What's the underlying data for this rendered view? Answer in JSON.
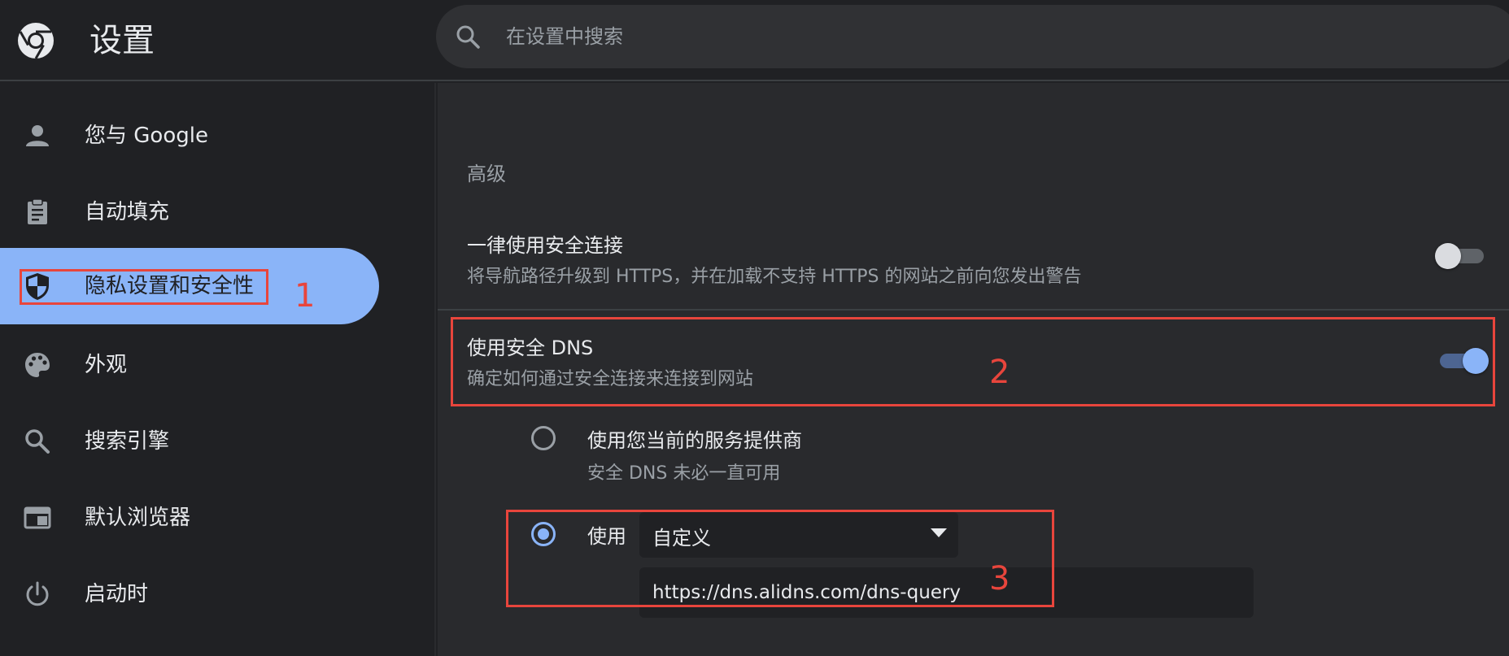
{
  "header": {
    "title": "设置",
    "search_placeholder": "在设置中搜索"
  },
  "sidebar": {
    "items": [
      {
        "label": "您与 Google",
        "icon": "person-icon"
      },
      {
        "label": "自动填充",
        "icon": "clipboard-icon"
      },
      {
        "label": "隐私设置和安全性",
        "icon": "shield-icon",
        "active": true
      },
      {
        "label": "外观",
        "icon": "palette-icon"
      },
      {
        "label": "搜索引擎",
        "icon": "search-icon"
      },
      {
        "label": "默认浏览器",
        "icon": "browser-window-icon"
      },
      {
        "label": "启动时",
        "icon": "power-icon"
      }
    ]
  },
  "main": {
    "section_title": "高级",
    "https_setting": {
      "title": "一律使用安全连接",
      "description": "将导航路径升级到 HTTPS，并在加载不支持 HTTPS 的网站之前向您发出警告",
      "enabled": false
    },
    "dns_setting": {
      "title": "使用安全 DNS",
      "description": "确定如何通过安全连接来连接到网站",
      "enabled": true
    },
    "dns_options": {
      "current_provider": {
        "title": "使用您当前的服务提供商",
        "description": "安全 DNS 未必一直可用",
        "selected": false
      },
      "custom": {
        "label": "使用",
        "selected": true,
        "select_value": "自定义",
        "url_value": "https://dns.alidns.com/dns-query"
      }
    }
  },
  "annotations": {
    "label_1": "1",
    "label_2": "2",
    "label_3": "3"
  },
  "colors": {
    "accent": "#8ab4f8",
    "background": "#202124",
    "panel": "#292a2d",
    "annotation": "#e8453c"
  }
}
